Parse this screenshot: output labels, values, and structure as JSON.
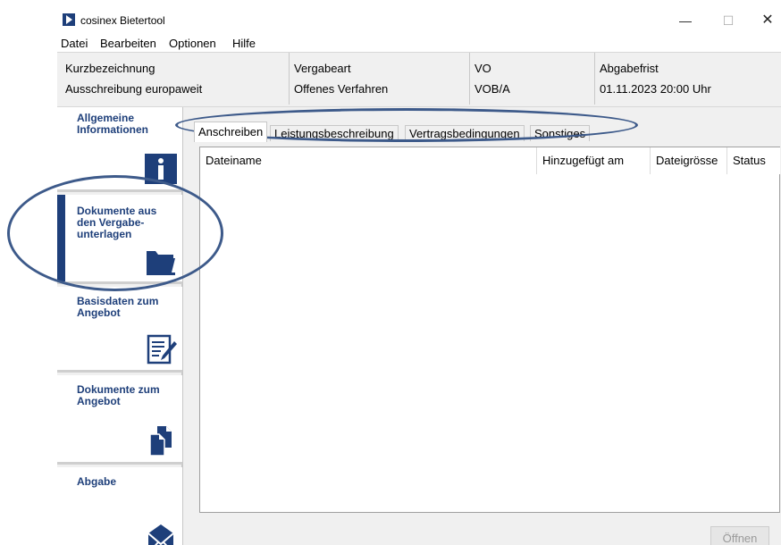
{
  "window": {
    "title": "cosinex Bietertool",
    "controls": {
      "minimize": "—",
      "maximize": "☐",
      "close": "✕"
    }
  },
  "menu": {
    "items": [
      "Datei",
      "Bearbeiten",
      "Optionen",
      "Hilfe"
    ]
  },
  "info": {
    "columns": [
      {
        "label": "Kurzbezeichnung",
        "value": "Ausschreibung europaweit"
      },
      {
        "label": "Vergabeart",
        "value": "Offenes Verfahren"
      },
      {
        "label": "VO",
        "value": "VOB/A"
      },
      {
        "label": "Abgabefrist",
        "value": "01.11.2023 20:00 Uhr"
      }
    ]
  },
  "sidebar": {
    "items": [
      {
        "label": "Allgemeine Informationen",
        "icon": "info-icon"
      },
      {
        "label": "Dokumente aus den Vergabe-unterlagen",
        "icon": "folder-icon",
        "active": true
      },
      {
        "label": "Basisdaten zum Angebot",
        "icon": "edit-document-icon"
      },
      {
        "label": "Dokumente zum Angebot",
        "icon": "documents-icon"
      },
      {
        "label": "Abgabe",
        "icon": "envelope-icon"
      }
    ]
  },
  "tabs": {
    "items": [
      "Anschreiben",
      "Leistungsbeschreibung",
      "Vertragsbedingungen",
      "Sonstiges"
    ],
    "active": "Anschreiben"
  },
  "table": {
    "columns": [
      "Dateiname",
      "Hinzugefügt am",
      "Dateigrösse",
      "Status"
    ],
    "rows": []
  },
  "actions": {
    "open_label": "Öffnen"
  },
  "colors": {
    "accent": "#1e3f7a",
    "annotation": "#3d5a8a"
  }
}
